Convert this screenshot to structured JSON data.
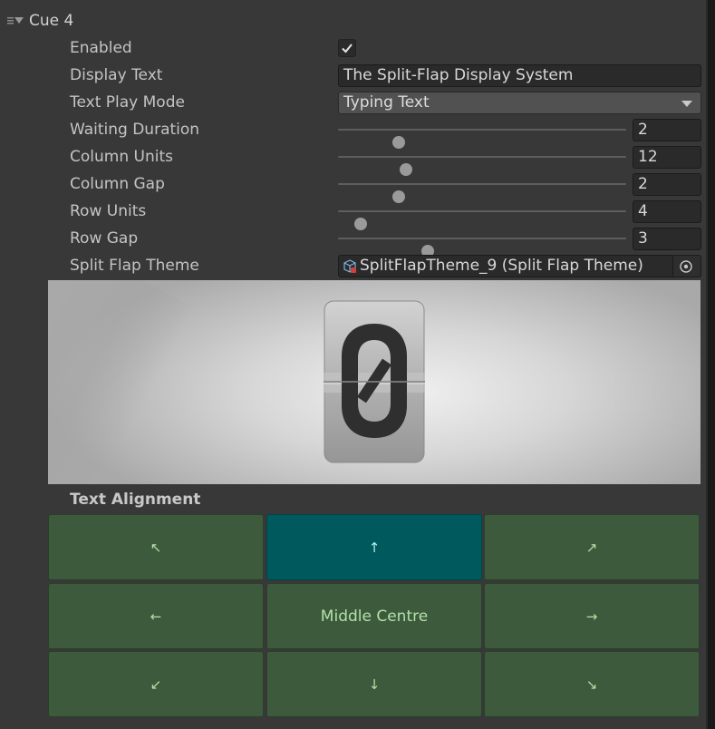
{
  "header": {
    "title": "Cue 4",
    "icon": "menu-collapse-icon"
  },
  "fields": {
    "enabled": {
      "label": "Enabled",
      "checked": true
    },
    "display_text": {
      "label": "Display Text",
      "value": "The Split-Flap Display System"
    },
    "text_play_mode": {
      "label": "Text Play Mode",
      "value": "Typing Text"
    },
    "waiting_duration": {
      "label": "Waiting Duration",
      "value": "2",
      "fraction": 0.21
    },
    "column_units": {
      "label": "Column Units",
      "value": "12",
      "fraction": 0.235
    },
    "column_gap": {
      "label": "Column Gap",
      "value": "2",
      "fraction": 0.21
    },
    "row_units": {
      "label": "Row Units",
      "value": "4",
      "fraction": 0.08
    },
    "row_gap": {
      "label": "Row Gap",
      "value": "3",
      "fraction": 0.31
    },
    "split_flap_theme": {
      "label": "Split Flap Theme",
      "value": "SplitFlapTheme_9 (Split Flap Theme)",
      "icon": "scriptable-object-icon"
    }
  },
  "preview": {
    "flap_character": "0"
  },
  "alignment": {
    "title": "Text Alignment",
    "selected": "upper-centre",
    "buttons": {
      "upper_left": "↖",
      "upper_centre": "↑",
      "upper_right": "↗",
      "middle_left": "←",
      "middle_centre": "Middle Centre",
      "middle_right": "→",
      "lower_left": "↙",
      "lower_centre": "↓",
      "lower_right": "↘"
    }
  },
  "colors": {
    "panel_bg": "#383838",
    "button_green": "#3e5a3c",
    "button_selected": "#005a5d",
    "button_text": "#b2e0a8"
  }
}
